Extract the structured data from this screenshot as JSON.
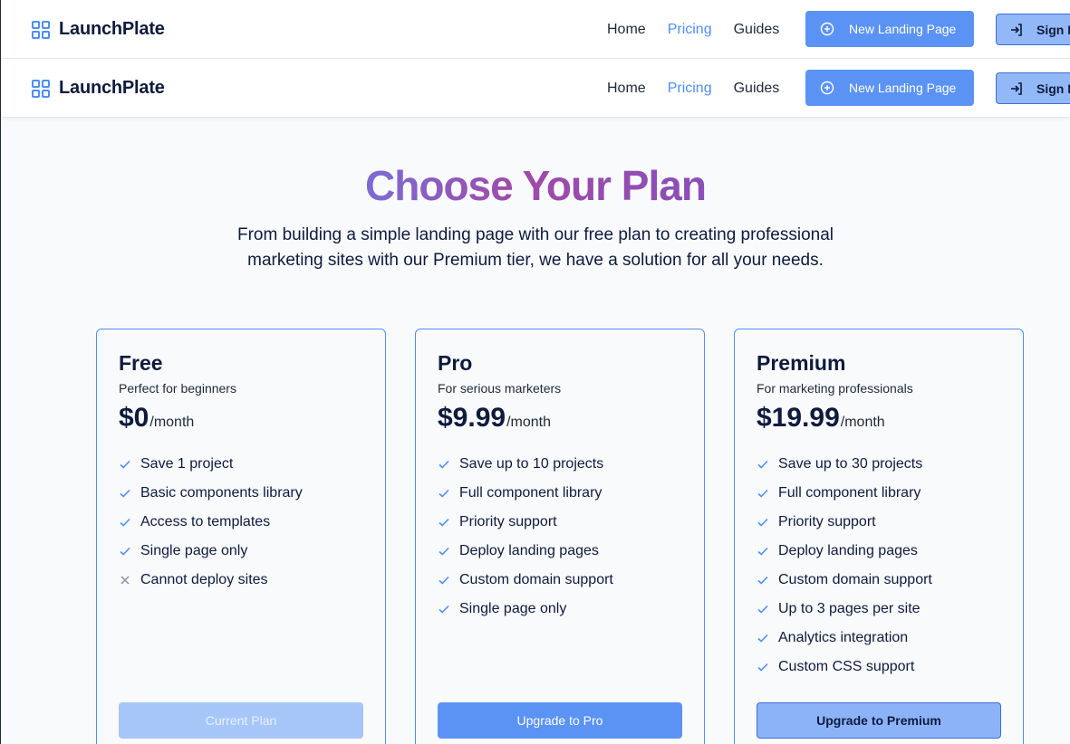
{
  "app": {
    "name": "LaunchPlate"
  },
  "nav": {
    "links": [
      "Home",
      "Pricing",
      "Guides"
    ],
    "active": "Pricing",
    "new_button": "New Landing Page",
    "sign_in": "Sign In"
  },
  "hero": {
    "title": "Choose Your Plan",
    "subtitle": "From building a simple landing page with our free plan to creating professional marketing sites with our Premium tier, we have a solution for all your needs."
  },
  "plans": [
    {
      "name": "Free",
      "tagline": "Perfect for beginners",
      "price": "$0",
      "period": "/month",
      "features": [
        {
          "text": "Save 1 project",
          "included": true
        },
        {
          "text": "Basic components library",
          "included": true
        },
        {
          "text": "Access to templates",
          "included": true
        },
        {
          "text": "Single page only",
          "included": true
        },
        {
          "text": "Cannot deploy sites",
          "included": false
        }
      ],
      "button": "Current Plan"
    },
    {
      "name": "Pro",
      "tagline": "For serious marketers",
      "price": "$9.99",
      "period": "/month",
      "features": [
        {
          "text": "Save up to 10 projects",
          "included": true
        },
        {
          "text": "Full component library",
          "included": true
        },
        {
          "text": "Priority support",
          "included": true
        },
        {
          "text": "Deploy landing pages",
          "included": true
        },
        {
          "text": "Custom domain support",
          "included": true
        },
        {
          "text": "Single page only",
          "included": true
        }
      ],
      "button": "Upgrade to Pro"
    },
    {
      "name": "Premium",
      "tagline": "For marketing professionals",
      "price": "$19.99",
      "period": "/month",
      "features": [
        {
          "text": "Save up to 30 projects",
          "included": true
        },
        {
          "text": "Full component library",
          "included": true
        },
        {
          "text": "Priority support",
          "included": true
        },
        {
          "text": "Deploy landing pages",
          "included": true
        },
        {
          "text": "Custom domain support",
          "included": true
        },
        {
          "text": "Up to 3 pages per site",
          "included": true
        },
        {
          "text": "Analytics integration",
          "included": true
        },
        {
          "text": "Custom CSS support",
          "included": true
        }
      ],
      "button": "Upgrade to Premium"
    }
  ],
  "colors": {
    "accent": "#4f8ef7",
    "heading": "#0f1b3d",
    "gradient_start": "#7c6cd4",
    "gradient_end": "#a04aa8"
  },
  "icons": {
    "logo": "grid-four-squares-icon",
    "new_page": "plus-circle-icon",
    "sign_in": "sign-in-arrow-icon",
    "included": "check-icon",
    "excluded": "x-icon"
  }
}
